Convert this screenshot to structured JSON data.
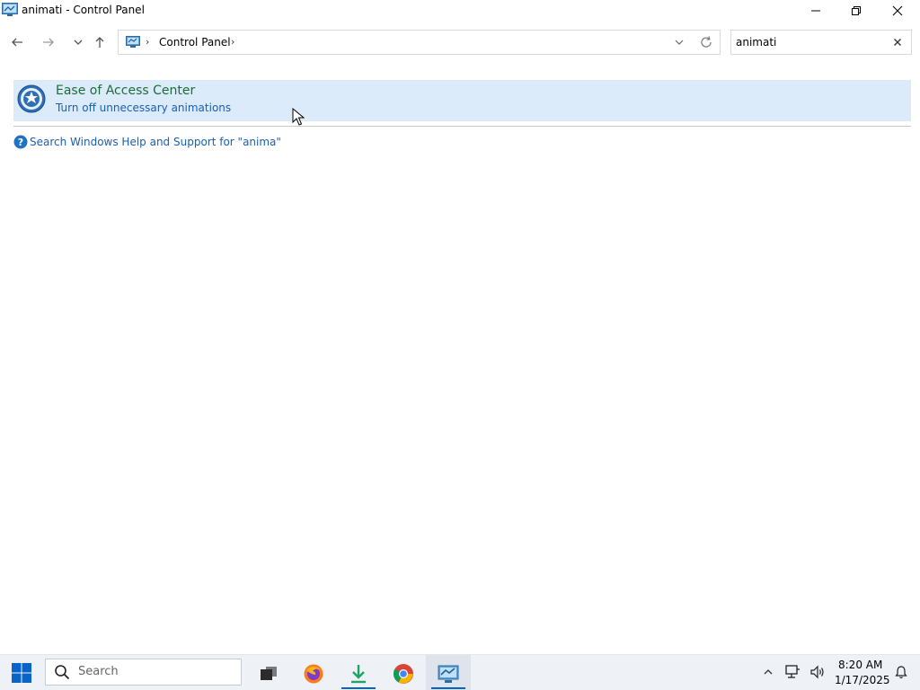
{
  "window": {
    "title": "animati - Control Panel",
    "controls": {
      "minimize": "minimize",
      "maximize": "restore",
      "close": "close"
    }
  },
  "nav": {
    "back": "arrow-left-icon",
    "forward": "arrow-right-icon",
    "recent": "chevron-down-icon",
    "up": "arrow-up-icon"
  },
  "address": {
    "crumb": "Control Panel",
    "separator": "›"
  },
  "search": {
    "value": "animati"
  },
  "results": [
    {
      "title": "Ease of Access Center",
      "link": "Turn off unnecessary animations"
    }
  ],
  "help": {
    "link": "Search Windows Help and Support for \"anima\""
  },
  "taskbar": {
    "search_placeholder": "Search",
    "apps": [
      "task-view",
      "firefox",
      "downloads",
      "chrome",
      "control-panel"
    ],
    "time": "8:20 AM",
    "date": "1/17/2025"
  },
  "colors": {
    "accent": "#0a64c8",
    "result_bg": "#dcebfa",
    "result_title": "#1e6b3a",
    "link": "#1a5fb4"
  }
}
